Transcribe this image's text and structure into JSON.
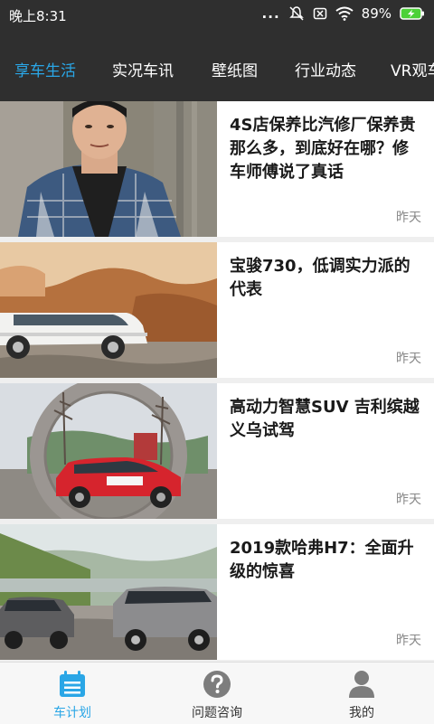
{
  "status_bar": {
    "time": "晚上8:31",
    "signal_dots": "...",
    "battery_percent": "89%",
    "icons": [
      "mute-icon",
      "sim-off-icon",
      "wifi-icon",
      "battery-charging-icon"
    ]
  },
  "tabs": [
    {
      "label": "享车生活",
      "active": true
    },
    {
      "label": "实况车讯",
      "active": false
    },
    {
      "label": "壁纸图",
      "active": false
    },
    {
      "label": "行业动态",
      "active": false
    },
    {
      "label": "VR观车",
      "active": false
    }
  ],
  "articles": [
    {
      "title": "4S店保养比汽修厂保养贵那么多，到底好在哪？修车师傅说了真话",
      "date": "昨天",
      "image": "man-in-plaid-shirt-photo"
    },
    {
      "title": "宝骏730，低调实力派的代表",
      "date": "昨天",
      "image": "white-mpv-rocky-coast-photo"
    },
    {
      "title": "高动力智慧SUV 吉利缤越义乌试驾",
      "date": "昨天",
      "image": "red-suv-circular-arch-photo"
    },
    {
      "title": "2019款哈弗H7：全面升级的惊喜",
      "date": "昨天",
      "image": "two-gray-suvs-mountain-road-photo"
    }
  ],
  "bottom_nav": [
    {
      "label": "车计划",
      "icon": "calendar-icon",
      "active": true
    },
    {
      "label": "问题咨询",
      "icon": "question-icon",
      "active": false
    },
    {
      "label": "我的",
      "icon": "user-icon",
      "active": false
    }
  ],
  "colors": {
    "accent": "#2aa6e6",
    "header_bg": "#2f2f2f",
    "battery": "#4cd137"
  }
}
